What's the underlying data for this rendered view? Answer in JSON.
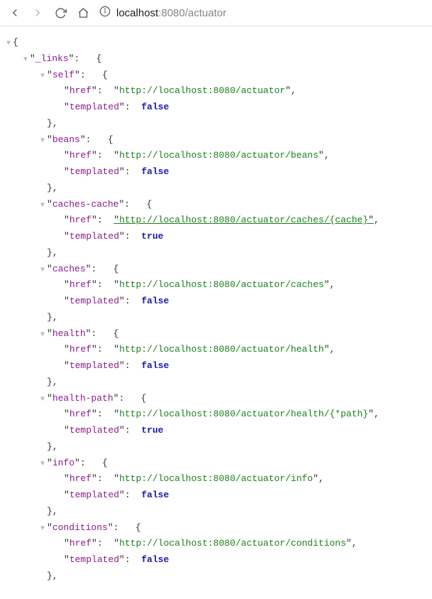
{
  "toolbar": {
    "url_prefix_icon": "ⓘ",
    "url_host": "localhost",
    "url_port_path": ":8080/actuator"
  },
  "json": {
    "root_key": "_links",
    "entries": [
      {
        "key": "self",
        "href": "http://localhost:8080/actuator",
        "templated": "false",
        "link": false
      },
      {
        "key": "beans",
        "href": "http://localhost:8080/actuator/beans",
        "templated": "false",
        "link": false
      },
      {
        "key": "caches-cache",
        "href": "http://localhost:8080/actuator/caches/{cache}",
        "templated": "true",
        "link": true
      },
      {
        "key": "caches",
        "href": "http://localhost:8080/actuator/caches",
        "templated": "false",
        "link": false
      },
      {
        "key": "health",
        "href": "http://localhost:8080/actuator/health",
        "templated": "false",
        "link": false
      },
      {
        "key": "health-path",
        "href": "http://localhost:8080/actuator/health/{*path}",
        "templated": "true",
        "link": false
      },
      {
        "key": "info",
        "href": "http://localhost:8080/actuator/info",
        "templated": "false",
        "link": false
      },
      {
        "key": "conditions",
        "href": "http://localhost:8080/actuator/conditions",
        "templated": "false",
        "link": false
      }
    ],
    "labels": {
      "href": "href",
      "templated": "templated"
    }
  }
}
